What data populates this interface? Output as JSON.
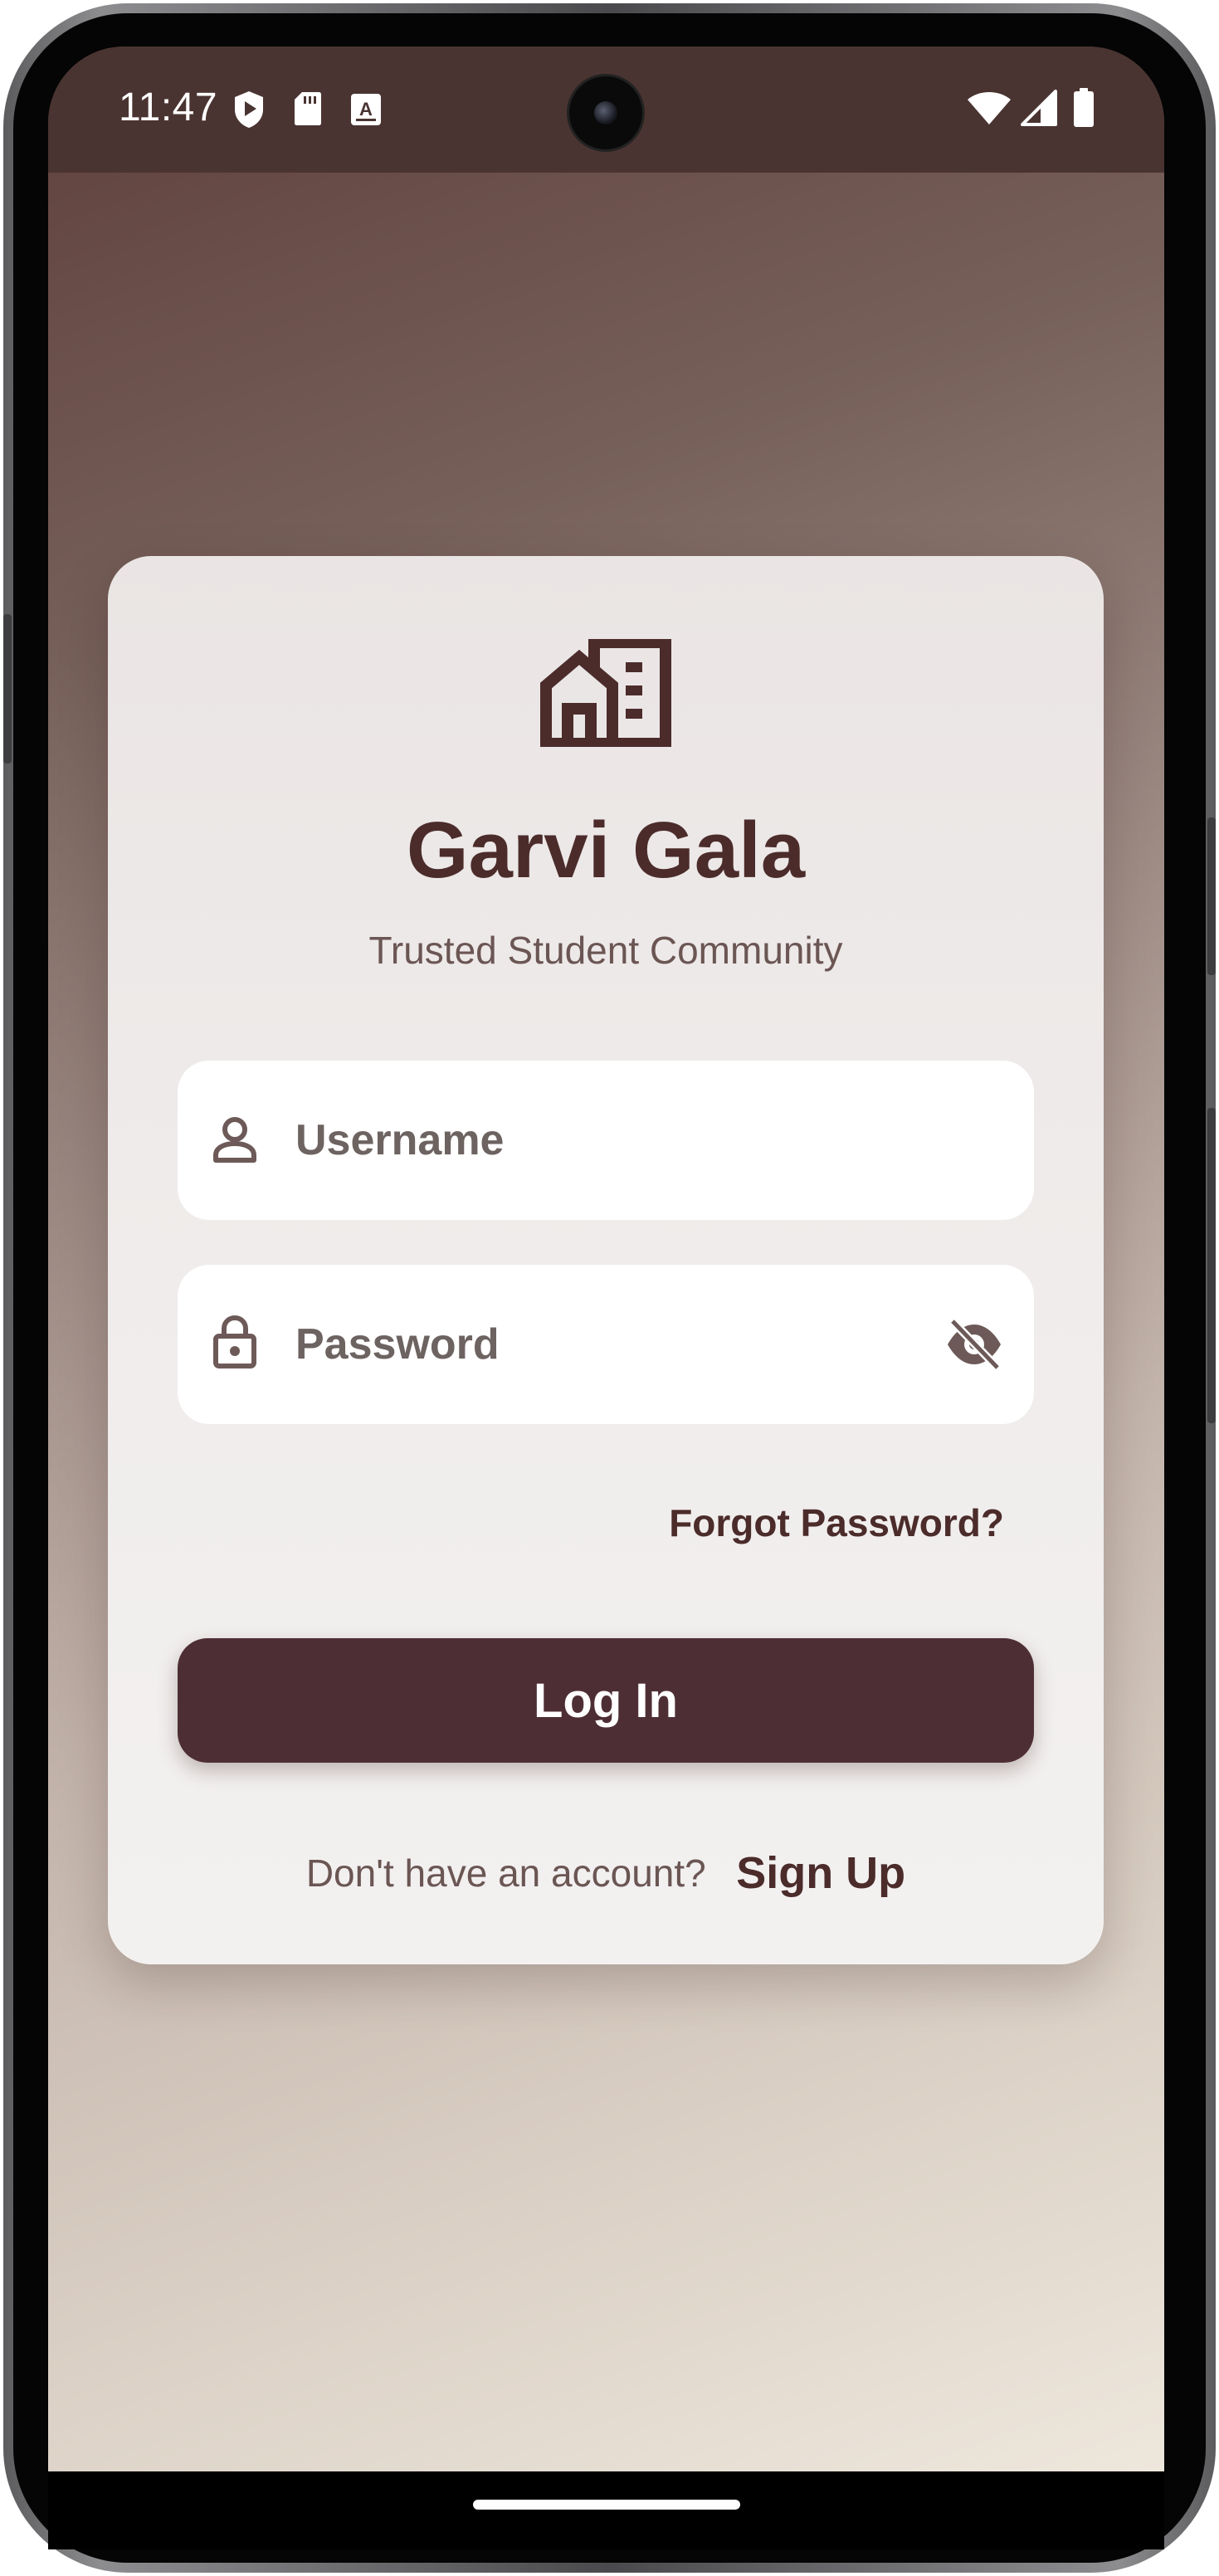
{
  "status_bar": {
    "time": "11:47",
    "left_icons": [
      "shield-play-icon",
      "sd-card-icon",
      "keyboard-a-icon"
    ],
    "right_icons": [
      "wifi-icon",
      "cell-signal-icon",
      "battery-icon"
    ]
  },
  "app": {
    "logo_icon": "building-house-icon",
    "title": "Garvi Gala",
    "subtitle": "Trusted Student Community"
  },
  "login_form": {
    "username": {
      "placeholder": "Username",
      "value": "",
      "icon": "person-icon"
    },
    "password": {
      "placeholder": "Password",
      "value": "",
      "icon": "lock-icon",
      "toggle_icon": "eye-off-icon"
    },
    "forgot_password_label": "Forgot Password?",
    "login_button_label": "Log In",
    "signup_prompt": "Don't have an account?",
    "signup_link_label": "Sign Up"
  },
  "colors": {
    "primary_dark": "#4b2c2b",
    "button": "#4e2e35",
    "status_bar": "#4a3431",
    "card": "#efeceb",
    "text_muted": "#6b5654"
  }
}
